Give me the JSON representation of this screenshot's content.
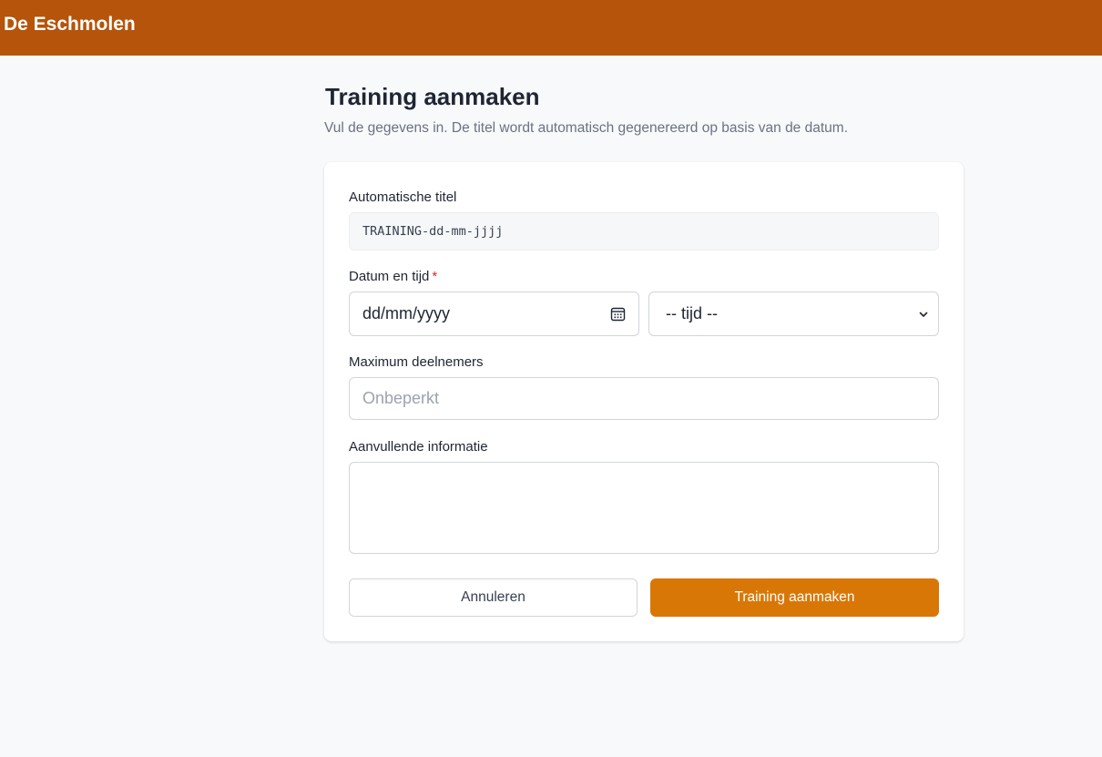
{
  "header": {
    "brand": "De Eschmolen",
    "brand_color": "#b5540a"
  },
  "page": {
    "title": "Training aanmaken",
    "subtitle": "Vul de gegevens in. De titel wordt automatisch gegenereerd op basis van de datum."
  },
  "form": {
    "auto_title": {
      "label": "Automatische titel",
      "value": "TRAINING-dd-mm-jjjj"
    },
    "datetime": {
      "label": "Datum en tijd",
      "required_marker": "*",
      "date_placeholder": "dd/mm/yyyy",
      "date_icon": "calendar-icon",
      "time_selected": "-- tijd --",
      "time_icon": "chevron-down-icon"
    },
    "max_participants": {
      "label": "Maximum deelnemers",
      "placeholder": "Onbeperkt"
    },
    "extra_info": {
      "label": "Aanvullende informatie",
      "value": ""
    },
    "buttons": {
      "cancel_label": "Annuleren",
      "submit_label": "Training aanmaken",
      "submit_color": "#d97706"
    }
  }
}
